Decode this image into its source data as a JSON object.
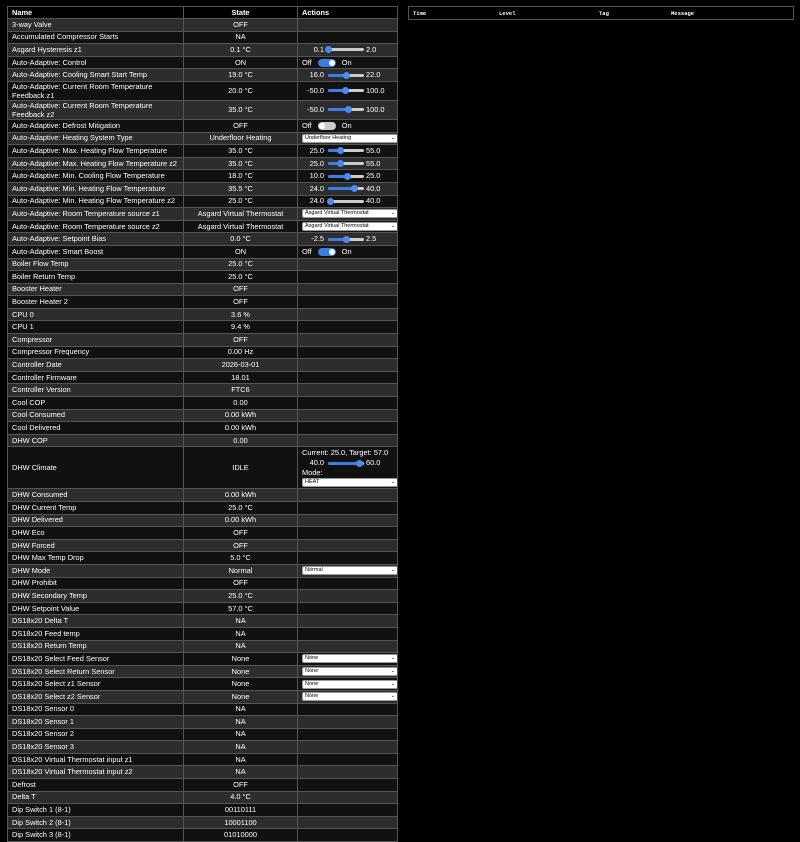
{
  "headers": {
    "name": "Name",
    "state": "State",
    "actions": "Actions"
  },
  "log_headers": {
    "time": "Time",
    "level": "Level",
    "tag": "Tag",
    "message": "Message"
  },
  "rows": [
    {
      "name": "3-way Valve",
      "state": "OFF"
    },
    {
      "name": "Accumulated Compressor Starts",
      "state": "NA"
    },
    {
      "name": "Asgard Hysteresis z1",
      "state": "0.1 °C",
      "action": {
        "type": "slider",
        "min": "0.1",
        "max": "2.0",
        "pos": 0.0
      }
    },
    {
      "name": "Auto-Adaptive: Control",
      "state": "ON",
      "action": {
        "type": "toggle",
        "off": "Off",
        "on": "On",
        "value": true
      }
    },
    {
      "name": "Auto-Adaptive: Cooling Smart Start Temp",
      "state": "19.0 °C",
      "action": {
        "type": "slider",
        "min": "16.0",
        "max": "22.0",
        "pos": 0.5
      }
    },
    {
      "name": "Auto-Adaptive: Current Room Temperature Feedback z1",
      "state": "20.0 °C",
      "action": {
        "type": "slider",
        "min": "-50.0",
        "max": "100.0",
        "pos": 0.47
      },
      "wrap": true
    },
    {
      "name": "Auto-Adaptive: Current Room Temperature Feedback z2",
      "state": "35.0 °C",
      "action": {
        "type": "slider",
        "min": "-50.0",
        "max": "100.0",
        "pos": 0.56
      },
      "wrap": true
    },
    {
      "name": "Auto-Adaptive: Defrost Mitigation",
      "state": "OFF",
      "action": {
        "type": "toggle",
        "off": "Off",
        "on": "On",
        "value": false
      }
    },
    {
      "name": "Auto-Adaptive: Heating System Type",
      "state": "Underfloor Heating",
      "action": {
        "type": "select",
        "value": "Underfloor Heating"
      }
    },
    {
      "name": "Auto-Adaptive: Max. Heating Flow Temperature",
      "state": "35.0 °C",
      "action": {
        "type": "slider",
        "min": "25.0",
        "max": "55.0",
        "pos": 0.33
      }
    },
    {
      "name": "Auto-Adaptive: Max. Heating Flow Temperature z2",
      "state": "35.0 °C",
      "action": {
        "type": "slider",
        "min": "25.0",
        "max": "55.0",
        "pos": 0.33
      }
    },
    {
      "name": "Auto-Adaptive: Min. Cooling Flow Temperature",
      "state": "18.0 °C",
      "action": {
        "type": "slider",
        "min": "10.0",
        "max": "25.0",
        "pos": 0.53
      }
    },
    {
      "name": "Auto-Adaptive: Min. Heating Flow Temperature",
      "state": "35.5 °C",
      "action": {
        "type": "slider",
        "min": "24.0",
        "max": "40.0",
        "pos": 0.72
      }
    },
    {
      "name": "Auto-Adaptive: Min. Heating Flow Temperature z2",
      "state": "25.0 °C",
      "action": {
        "type": "slider",
        "min": "24.0",
        "max": "40.0",
        "pos": 0.06
      }
    },
    {
      "name": "Auto-Adaptive: Room Temperature source z1",
      "state": "Asgard Virtual Thermostat",
      "action": {
        "type": "select",
        "value": "Asgard Virtual Thermostat"
      }
    },
    {
      "name": "Auto-Adaptive: Room Temperature source z2",
      "state": "Asgard Virtual Thermostat",
      "action": {
        "type": "select",
        "value": "Asgard Virtual Thermostat"
      }
    },
    {
      "name": "Auto-Adaptive: Setpoint Bias",
      "state": "0.0 °C",
      "action": {
        "type": "slider",
        "min": "-2.5",
        "max": "2.5",
        "pos": 0.5
      }
    },
    {
      "name": "Auto-Adaptive: Smart Boost",
      "state": "ON",
      "action": {
        "type": "toggle",
        "off": "Off",
        "on": "On",
        "value": true
      }
    },
    {
      "name": "Boiler Flow Temp",
      "state": "25.0 °C"
    },
    {
      "name": "Boiler Return Temp",
      "state": "25.0 °C"
    },
    {
      "name": "Booster Heater",
      "state": "OFF"
    },
    {
      "name": "Booster Heater 2",
      "state": "OFF"
    },
    {
      "name": "CPU 0",
      "state": "3.6 %"
    },
    {
      "name": "CPU 1",
      "state": "9.4 %"
    },
    {
      "name": "Compressor",
      "state": "OFF"
    },
    {
      "name": "Compressor Frequency",
      "state": "0.00 Hz"
    },
    {
      "name": "Controller Date",
      "state": "2026-03-01"
    },
    {
      "name": "Controller Firmware",
      "state": "18.01"
    },
    {
      "name": "Controller Version",
      "state": "FTC6"
    },
    {
      "name": "Cool COP",
      "state": "0.00"
    },
    {
      "name": "Cool Consumed",
      "state": "0.00 kWh"
    },
    {
      "name": "Cool Delivered",
      "state": "0.00 kWh"
    },
    {
      "name": "DHW COP",
      "state": "0.00"
    },
    {
      "name": "DHW Climate",
      "state": "IDLE",
      "action": {
        "type": "climate",
        "current": "Current: 25.0, Target: 57.0",
        "min": "40.0",
        "max": "60.0",
        "pos": 0.85,
        "mode_label": "Mode:",
        "mode": "HEAT"
      }
    },
    {
      "name": "DHW Consumed",
      "state": "0.00 kWh"
    },
    {
      "name": "DHW Current Temp",
      "state": "25.0 °C"
    },
    {
      "name": "DHW Delivered",
      "state": "0.00 kWh"
    },
    {
      "name": "DHW Eco",
      "state": "OFF"
    },
    {
      "name": "DHW Forced",
      "state": "OFF"
    },
    {
      "name": "DHW Max Temp Drop",
      "state": "5.0 °C"
    },
    {
      "name": "DHW Mode",
      "state": "Normal",
      "action": {
        "type": "select",
        "value": "Normal"
      }
    },
    {
      "name": "DHW Prohibit",
      "state": "OFF"
    },
    {
      "name": "DHW Secondary Temp",
      "state": "25.0 °C"
    },
    {
      "name": "DHW Setpoint Value",
      "state": "57.0 °C"
    },
    {
      "name": "DS18x20 Delta T",
      "state": "NA"
    },
    {
      "name": "DS18x20 Feed temp",
      "state": "NA"
    },
    {
      "name": "DS18x20 Return Temp",
      "state": "NA"
    },
    {
      "name": "DS18x20 Select Feed Sensor",
      "state": "None",
      "action": {
        "type": "select",
        "value": "None"
      }
    },
    {
      "name": "DS18x20 Select Return Sensor",
      "state": "None",
      "action": {
        "type": "select",
        "value": "None"
      }
    },
    {
      "name": "DS18x20 Select z1 Sensor",
      "state": "None",
      "action": {
        "type": "select",
        "value": "None"
      }
    },
    {
      "name": "DS18x20 Select z2 Sensor",
      "state": "None",
      "action": {
        "type": "select",
        "value": "None"
      }
    },
    {
      "name": "DS18x20 Sensor 0",
      "state": "NA"
    },
    {
      "name": "DS18x20 Sensor 1",
      "state": "NA"
    },
    {
      "name": "DS18x20 Sensor 2",
      "state": "NA"
    },
    {
      "name": "DS18x20 Sensor 3",
      "state": "NA"
    },
    {
      "name": "DS18x20 Virtual Thermostat input z1",
      "state": "NA"
    },
    {
      "name": "DS18x20 Virtual Thermostat input z2",
      "state": "NA"
    },
    {
      "name": "Defrost",
      "state": "OFF"
    },
    {
      "name": "Delta T",
      "state": "4.0 °C"
    },
    {
      "name": "Dip Switch 1 (8-1)",
      "state": "00110111"
    },
    {
      "name": "Dip Switch 2 (8-1)",
      "state": "10001100"
    },
    {
      "name": "Dip Switch 3 (8-1)",
      "state": "01010000"
    }
  ]
}
